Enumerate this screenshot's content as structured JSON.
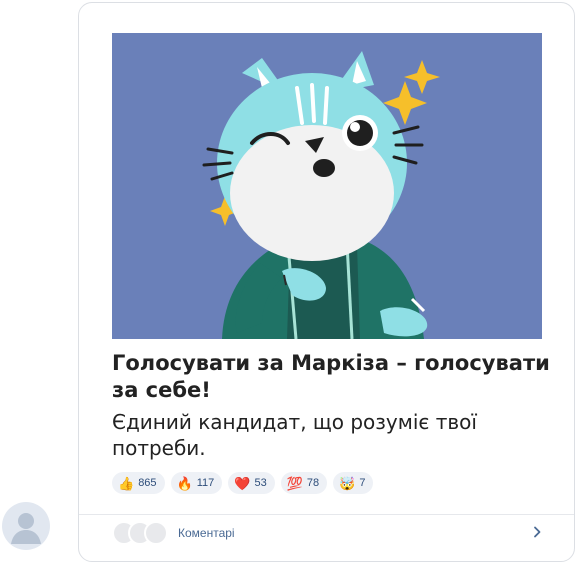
{
  "post": {
    "title": "Голосувати за Маркіза – голосувати за себе!",
    "subtitle": "Єдиний кандидат, що розуміє твої потреби.",
    "sticker_icon": "cat-wink-sticker"
  },
  "reactions": [
    {
      "emoji": "👍",
      "icon": "thumbs-up-icon",
      "count": "865"
    },
    {
      "emoji": "🔥",
      "icon": "fire-icon",
      "count": "117"
    },
    {
      "emoji": "❤️",
      "icon": "heart-icon",
      "count": "53"
    },
    {
      "emoji": "💯",
      "icon": "hundred-points-icon",
      "count": "78"
    },
    {
      "emoji": "🤯",
      "icon": "exploding-head-icon",
      "count": "7"
    }
  ],
  "footer": {
    "comments_label": "Коментарі"
  },
  "colors": {
    "sticker_bg": "#6a80b9",
    "accent_text": "#2d4d7a",
    "chip_bg": "#eef1f6"
  }
}
